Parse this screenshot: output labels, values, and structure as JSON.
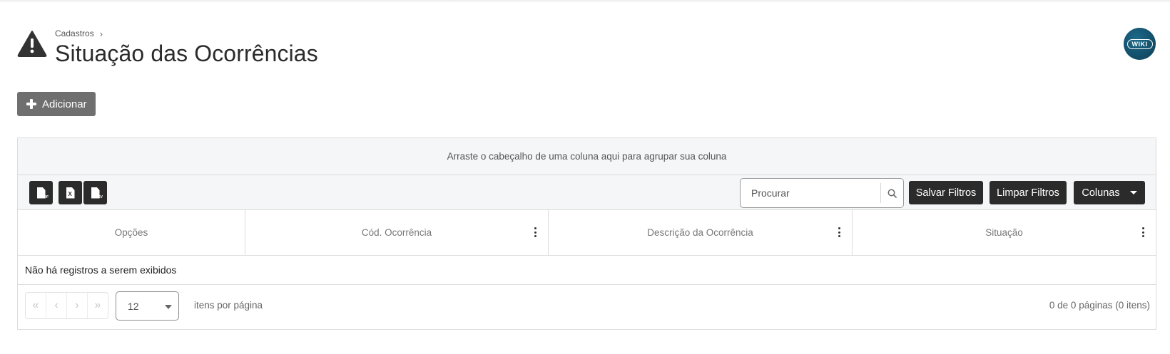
{
  "breadcrumb": {
    "parent": "Cadastros",
    "separator": "›"
  },
  "page": {
    "title": "Situação das Ocorrências"
  },
  "wiki": {
    "label": "WIKI"
  },
  "actions": {
    "add_label": "Adicionar"
  },
  "grid": {
    "group_panel_text": "Arraste o cabeçalho de uma coluna aqui para agrupar sua coluna",
    "export_buttons": [
      {
        "icon": "pdf-file-icon",
        "tag": "PDF"
      },
      {
        "icon": "excel-file-icon",
        "tag": "X"
      },
      {
        "icon": "csv-file-icon",
        "tag": "CSV"
      }
    ],
    "search": {
      "placeholder": "Procurar",
      "value": ""
    },
    "save_filters_label": "Salvar Filtros",
    "clear_filters_label": "Limpar Filtros",
    "columns_label": "Colunas",
    "columns": [
      {
        "label": "Opções"
      },
      {
        "label": "Cód. Ocorrência"
      },
      {
        "label": "Descrição da Ocorrência"
      },
      {
        "label": "Situação"
      }
    ],
    "empty_message": "Não há registros a serem exibidos",
    "pager": {
      "nav": [
        "«",
        "‹",
        "›",
        "»"
      ],
      "page_size": "12",
      "per_page_label": "itens por página",
      "info": "0 de 0 páginas (0 itens)"
    }
  },
  "colors": {
    "dark_button": "#2b2b2b",
    "add_button": "#6f6f6f",
    "wiki_badge": "#0d3e55",
    "panel_bg": "#f5f6f7"
  }
}
